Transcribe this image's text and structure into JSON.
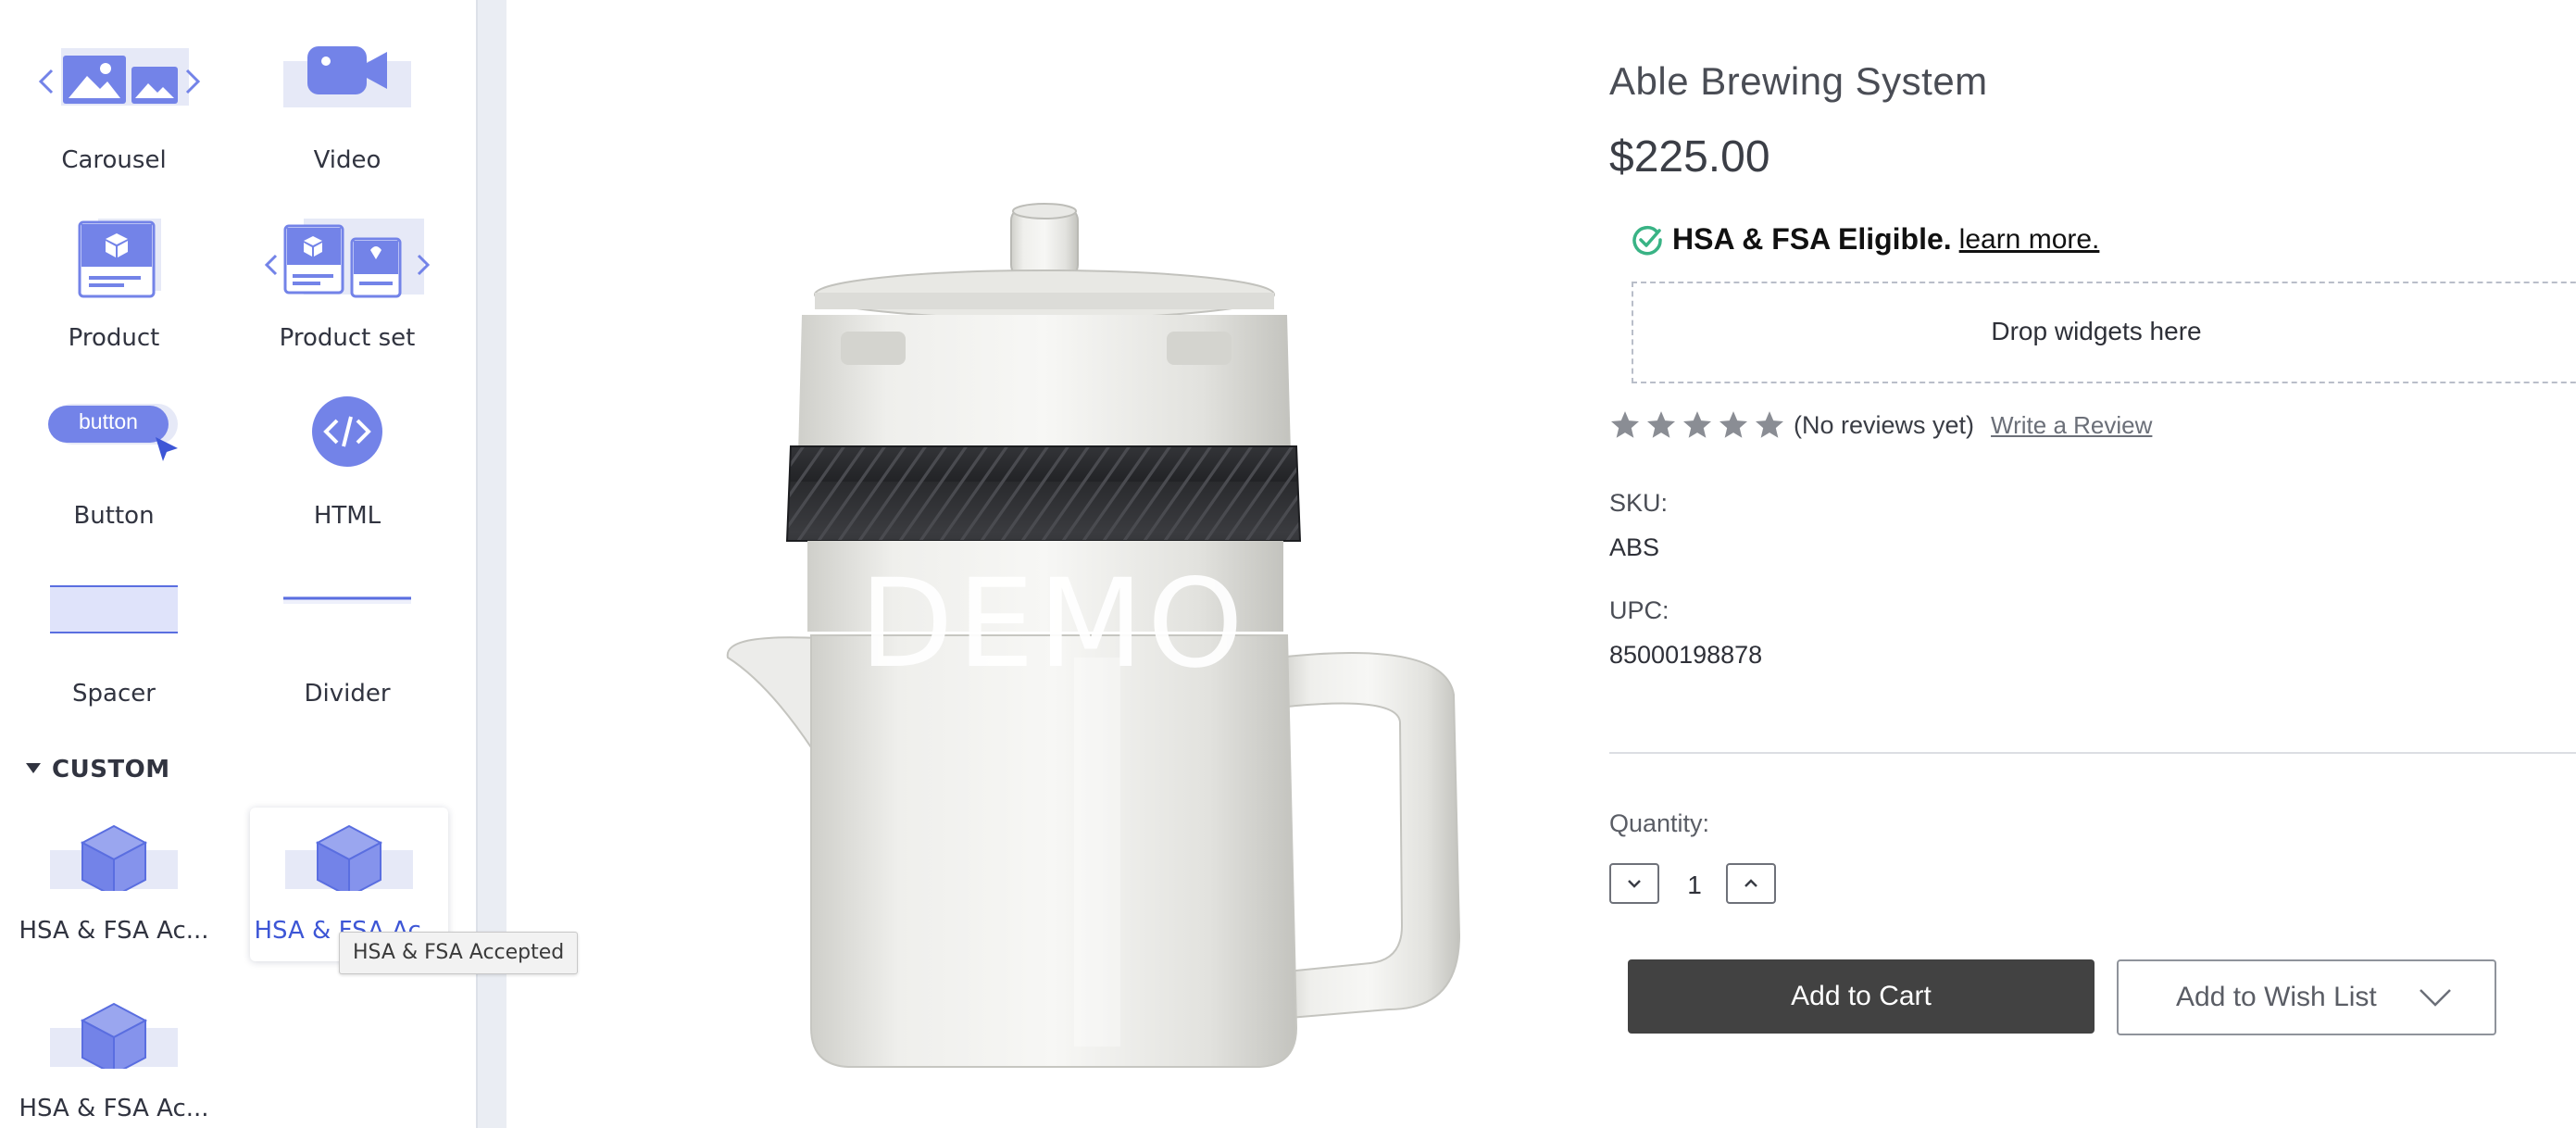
{
  "sidebar": {
    "widgets": [
      {
        "label": "Carousel"
      },
      {
        "label": "Video"
      },
      {
        "label": "Product"
      },
      {
        "label": "Product set"
      },
      {
        "label": "Button",
        "button_text": "button"
      },
      {
        "label": "HTML"
      },
      {
        "label": "Spacer"
      },
      {
        "label": "Divider"
      }
    ],
    "custom_heading": "CUSTOM",
    "custom_widgets": [
      {
        "label": "HSA & FSA Ac..."
      },
      {
        "label": "HSA & FSA Ac..."
      },
      {
        "label": "HSA & FSA Ac..."
      }
    ],
    "tooltip": "HSA & FSA Accepted"
  },
  "product": {
    "watermark": "DEMO",
    "title": "Able Brewing System",
    "price": "$225.00",
    "hsa_text": "HSA & FSA Eligible.",
    "hsa_link": "learn more.",
    "drop_zone": "Drop widgets here",
    "rating_stars": 5,
    "review_count": "(No reviews yet)",
    "write_review": "Write a Review",
    "sku_label": "SKU:",
    "sku_value": "ABS",
    "upc_label": "UPC:",
    "upc_value": "85000198878",
    "quantity_label": "Quantity:",
    "quantity_value": "1",
    "add_to_cart": "Add to Cart",
    "add_to_wishlist": "Add to Wish List"
  },
  "colors": {
    "accent": "#7383e8",
    "hsa_check": "#39b385",
    "star": "#8a8d94",
    "cart_button": "#424242"
  }
}
